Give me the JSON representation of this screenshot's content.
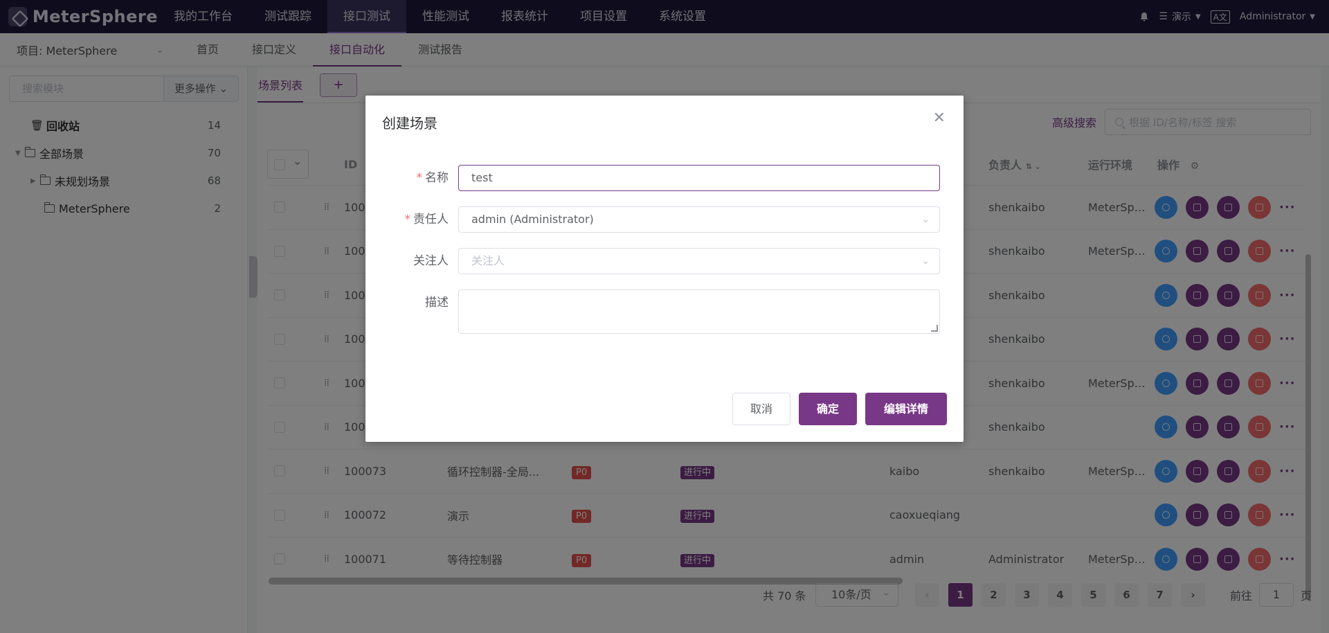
{
  "app": {
    "logo_text": "MeterSphere"
  },
  "topnav": {
    "items": [
      {
        "label": "我的工作台"
      },
      {
        "label": "测试跟踪"
      },
      {
        "label": "接口测试"
      },
      {
        "label": "性能测试"
      },
      {
        "label": "报表统计"
      },
      {
        "label": "项目设置"
      },
      {
        "label": "系统设置"
      }
    ],
    "active_index": 2,
    "workspace": "演示",
    "user": "Administrator"
  },
  "subnav": {
    "project_label": "项目: MeterSphere",
    "items": [
      {
        "label": "首页"
      },
      {
        "label": "接口定义"
      },
      {
        "label": "接口自动化"
      },
      {
        "label": "测试报告"
      }
    ],
    "active_index": 2
  },
  "sidebar": {
    "search_placeholder": "搜索模块",
    "more_ops": "更多操作",
    "tree": [
      {
        "label": "回收站",
        "count": "14",
        "kind": "trash"
      },
      {
        "label": "全部场景",
        "count": "70",
        "kind": "root"
      },
      {
        "label": "未规划场景",
        "count": "68",
        "kind": "child"
      },
      {
        "label": "MeterSphere",
        "count": "2",
        "kind": "leaf"
      }
    ]
  },
  "main": {
    "tab_label": "场景列表",
    "tab_add": "+",
    "advanced_search": "高级搜索",
    "search_placeholder": "根据 ID/名称/标签 搜索",
    "columns": {
      "id": "ID",
      "owner": "负责人",
      "env": "运行环境",
      "ops": "操作"
    },
    "rows": [
      {
        "id": "100",
        "name": "",
        "priority": "",
        "status": "",
        "creator": "",
        "owner": "shenkaibo",
        "env": "MeterSph..."
      },
      {
        "id": "100",
        "name": "",
        "priority": "",
        "status": "",
        "creator": "",
        "owner": "shenkaibo",
        "env": "MeterSph..."
      },
      {
        "id": "100",
        "name": "",
        "priority": "",
        "status": "",
        "creator": "",
        "owner": "shenkaibo",
        "env": ""
      },
      {
        "id": "100",
        "name": "",
        "priority": "",
        "status": "",
        "creator": "",
        "owner": "shenkaibo",
        "env": ""
      },
      {
        "id": "100",
        "name": "",
        "priority": "",
        "status": "",
        "creator": "",
        "owner": "shenkaibo",
        "env": "MeterSph..."
      },
      {
        "id": "100",
        "name": "",
        "priority": "",
        "status": "",
        "creator": "",
        "owner": "shenkaibo",
        "env": ""
      },
      {
        "id": "100073",
        "name": "循环控制器-全局...",
        "priority": "P0",
        "status": "进行中",
        "creator": "kaibo",
        "owner": "shenkaibo",
        "env": "MeterSph..."
      },
      {
        "id": "100072",
        "name": "演示",
        "priority": "P0",
        "status": "进行中",
        "creator": "caoxueqiang",
        "owner": "",
        "env": ""
      },
      {
        "id": "100071",
        "name": "等待控制器",
        "priority": "P0",
        "status": "进行中",
        "creator": "admin",
        "owner": "Administrator",
        "env": "MeterSph..."
      }
    ],
    "pager": {
      "total": "共 70 条",
      "page_size": "10条/页",
      "pages": [
        "1",
        "2",
        "3",
        "4",
        "5",
        "6",
        "7"
      ],
      "active_page": "1",
      "goto_label": "前往",
      "goto_value": "1",
      "goto_suffix": "页"
    }
  },
  "dialog": {
    "title": "创建场景",
    "close_icon": "close-icon",
    "fields": {
      "name_label": "名称",
      "name_value": "test",
      "owner_label": "责任人",
      "owner_value": "admin (Administrator)",
      "follower_label": "关注人",
      "follower_placeholder": "关注人",
      "desc_label": "描述",
      "desc_value": ""
    },
    "buttons": {
      "cancel": "取消",
      "confirm": "确定",
      "edit_details": "编辑详情"
    }
  },
  "colors": {
    "brand": "#783887",
    "topbar": "#1e1a3a",
    "danger": "#f56c6c",
    "run": "#409eff"
  }
}
